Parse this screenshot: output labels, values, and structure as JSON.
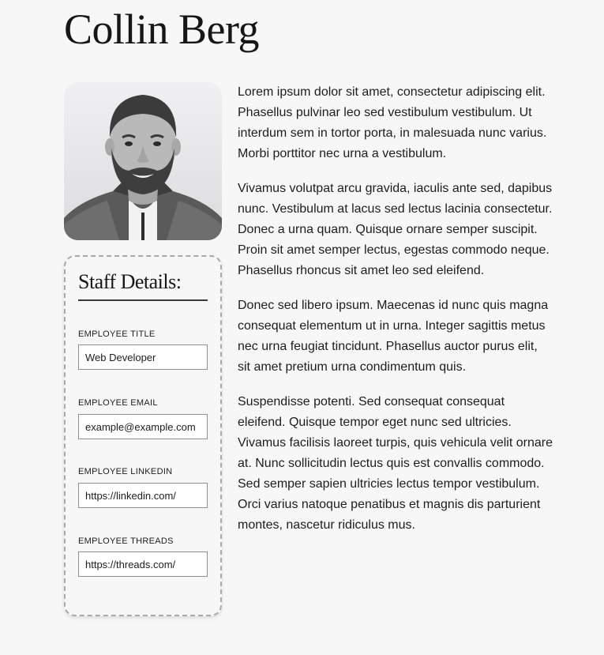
{
  "profile": {
    "name": "Collin Berg",
    "photo_icon": "person-portrait"
  },
  "details": {
    "title": "Staff Details:",
    "fields": [
      {
        "label": "EMPLOYEE TITLE",
        "value": "Web Developer"
      },
      {
        "label": "EMPLOYEE EMAIL",
        "value": "example@example.com"
      },
      {
        "label": "EMPLOYEE LINKEDIN",
        "value": "https://linkedin.com/"
      },
      {
        "label": "EMPLOYEE THREADS",
        "value": "https://threads.com/"
      }
    ]
  },
  "bio": {
    "paragraphs": [
      "Lorem ipsum dolor sit amet, consectetur adipiscing elit. Phasellus pulvinar leo sed vestibulum vestibulum. Ut interdum sem in tortor porta, in malesuada nunc varius. Morbi porttitor nec urna a vestibulum.",
      "Vivamus volutpat arcu gravida, iaculis ante sed, dapibus nunc. Vestibulum at lacus sed lectus lacinia consectetur. Donec a urna quam. Quisque ornare semper suscipit. Proin sit amet semper lectus, egestas commodo neque. Phasellus rhoncus sit amet leo sed eleifend.",
      "Donec sed libero ipsum. Maecenas id nunc quis magna consequat elementum ut in urna. Integer sagittis metus nec urna feugiat tincidunt. Phasellus auctor purus elit, sit amet pretium urna condimentum quis.",
      "Suspendisse potenti. Sed consequat consequat eleifend. Quisque tempor eget nunc sed ultricies. Vivamus facilisis laoreet turpis, quis vehicula velit ornare at. Nunc sollicitudin lectus quis est convallis commodo. Sed semper sapien ultricies lectus tempor vestibulum. Orci varius natoque penatibus et magnis dis parturient montes, nascetur ridiculus mus."
    ]
  }
}
